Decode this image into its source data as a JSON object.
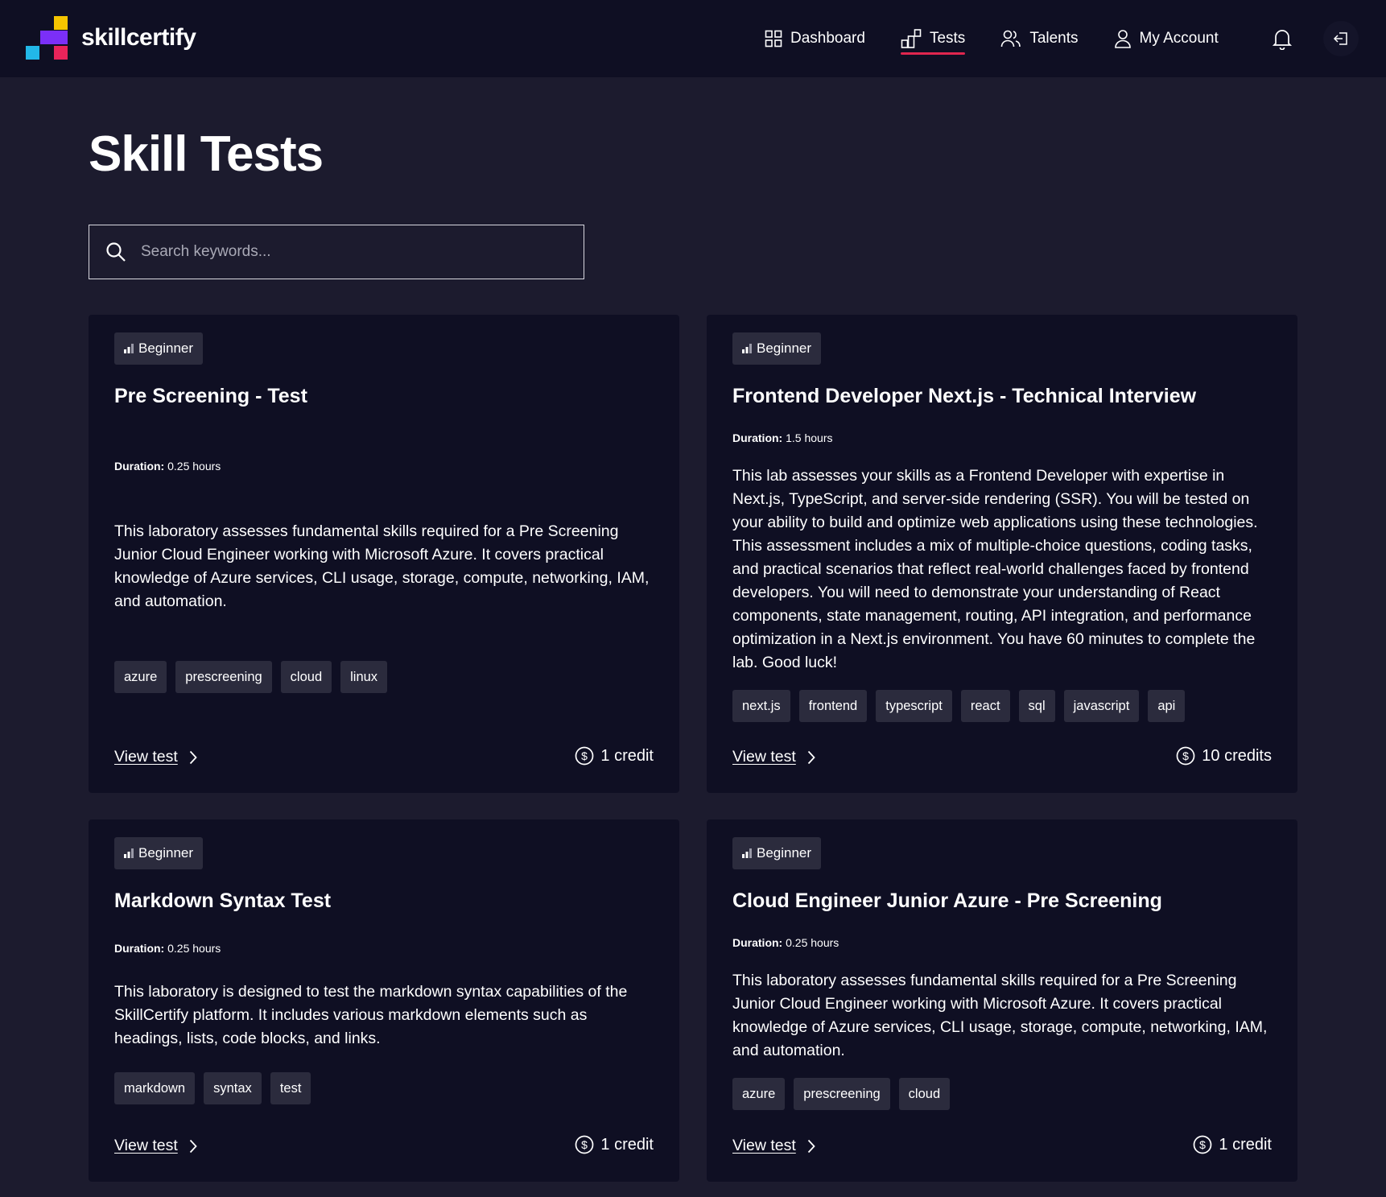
{
  "brand": {
    "name": "skillcertify",
    "colors": {
      "yellow": "#f5c400",
      "purple": "#7b2ff7",
      "cyan": "#22b8e8",
      "pink": "#e8245a"
    }
  },
  "nav": {
    "items": [
      {
        "label": "Dashboard",
        "icon": "grid-icon"
      },
      {
        "label": "Tests",
        "icon": "chart-blocks-icon",
        "active": true
      },
      {
        "label": "Talents",
        "icon": "users-icon"
      },
      {
        "label": "My Account",
        "icon": "user-icon"
      }
    ],
    "accent": "#e0264e"
  },
  "page": {
    "title": "Skill Tests",
    "search_placeholder": "Search keywords...",
    "search_value": ""
  },
  "cards": [
    {
      "level": "Beginner",
      "title": "Pre Screening - Test",
      "duration_label": "Duration:",
      "duration": "0.25 hours",
      "description": "This laboratory assesses fundamental skills required for a Pre Screening Junior Cloud Engineer working with Microsoft Azure. It covers practical knowledge of Azure services, CLI usage, storage, compute, networking, IAM, and automation.",
      "tags": [
        "azure",
        "prescreening",
        "cloud",
        "linux"
      ],
      "view_label": "View test",
      "credits": "1 credit"
    },
    {
      "level": "Beginner",
      "title": "Frontend Developer Next.js - Technical Interview",
      "duration_label": "Duration:",
      "duration": "1.5 hours",
      "description": "This lab assesses your skills as a Frontend Developer with expertise in Next.js, TypeScript, and server-side rendering (SSR). You will be tested on your ability to build and optimize web applications using these technologies. This assessment includes a mix of multiple-choice questions, coding tasks, and practical scenarios that reflect real-world challenges faced by frontend developers. You will need to demonstrate your understanding of React components, state management, routing, API integration, and performance optimization in a Next.js environment. You have 60 minutes to complete the lab. Good luck!",
      "tags": [
        "next.js",
        "frontend",
        "typescript",
        "react",
        "sql",
        "javascript",
        "api"
      ],
      "view_label": "View test",
      "credits": "10 credits"
    },
    {
      "level": "Beginner",
      "title": "Markdown Syntax Test",
      "duration_label": "Duration:",
      "duration": "0.25 hours",
      "description": "This laboratory is designed to test the markdown syntax capabilities of the SkillCertify platform. It includes various markdown elements such as headings, lists, code blocks, and links.",
      "tags": [
        "markdown",
        "syntax",
        "test"
      ],
      "view_label": "View test",
      "credits": "1 credit"
    },
    {
      "level": "Beginner",
      "title": "Cloud Engineer Junior Azure - Pre Screening",
      "duration_label": "Duration:",
      "duration": "0.25 hours",
      "description": "This laboratory assesses fundamental skills required for a Pre Screening Junior Cloud Engineer working with Microsoft Azure. It covers practical knowledge of Azure services, CLI usage, storage, compute, networking, IAM, and automation.",
      "tags": [
        "azure",
        "prescreening",
        "cloud"
      ],
      "view_label": "View test",
      "credits": "1 credit"
    }
  ]
}
